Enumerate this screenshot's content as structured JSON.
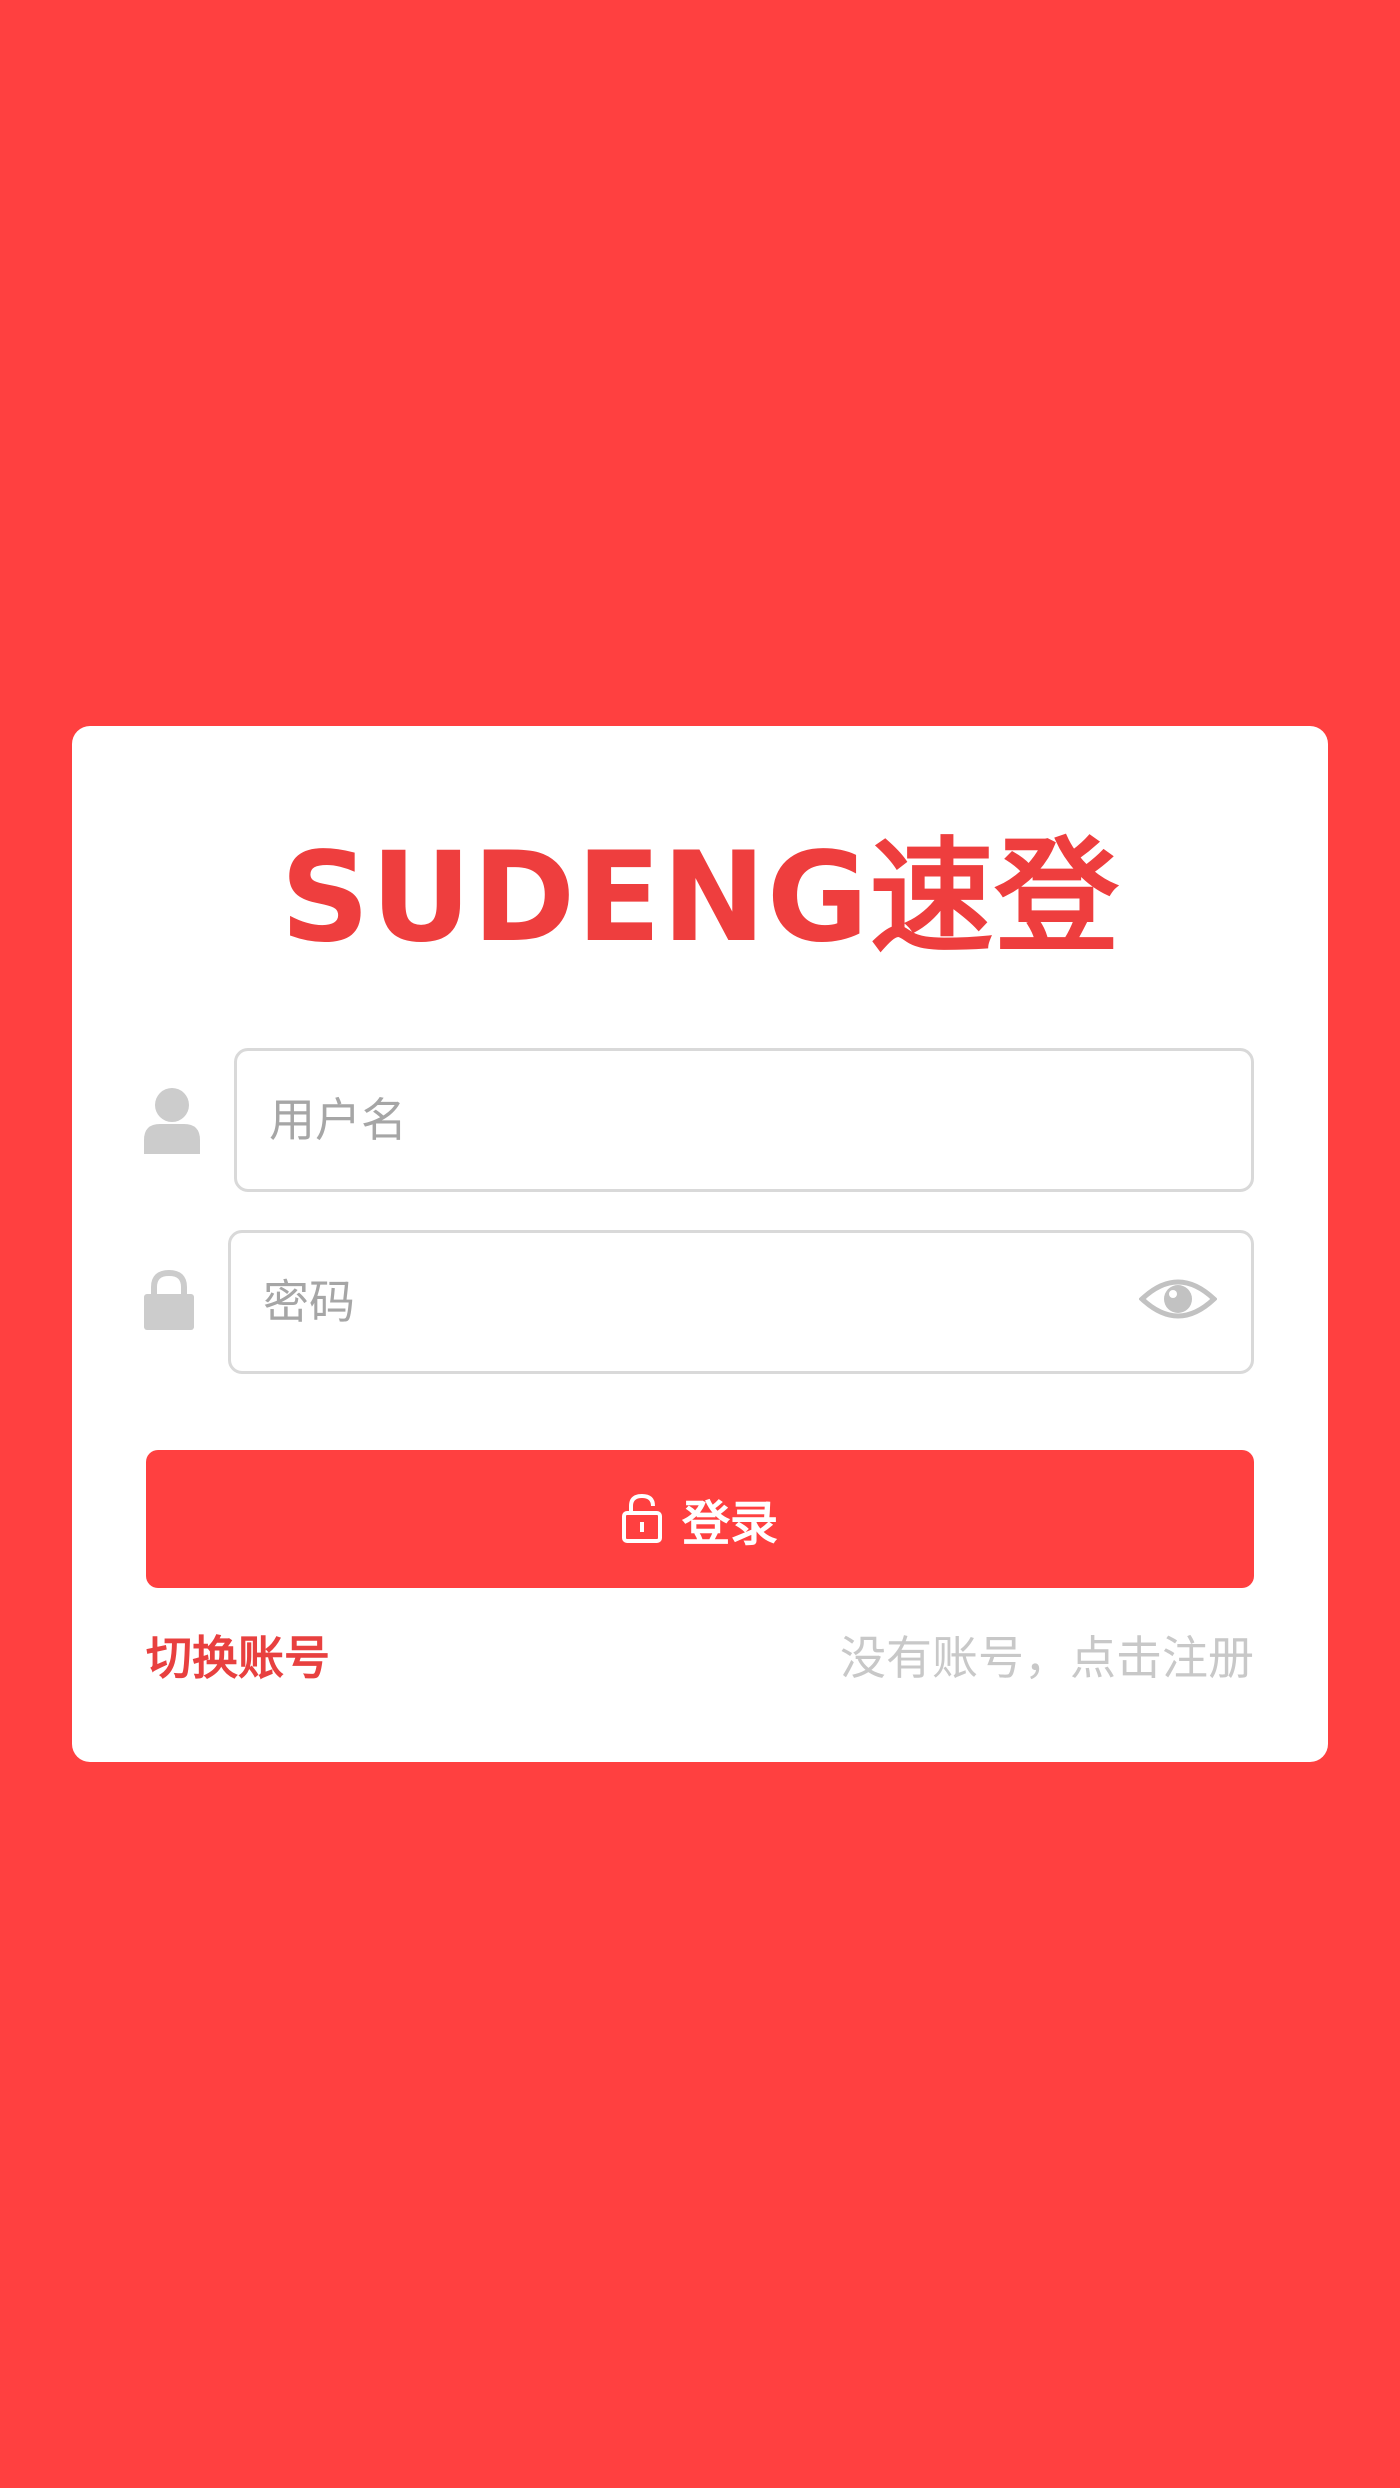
{
  "app": {
    "title": "SUDENG速登"
  },
  "form": {
    "username": {
      "value": "",
      "placeholder": "用户名",
      "icon": "user-icon"
    },
    "password": {
      "value": "",
      "placeholder": "密码",
      "icon": "lock-icon",
      "toggle_icon": "eye-icon"
    }
  },
  "actions": {
    "login_label": "登录",
    "login_icon": "lock-open-icon",
    "switch_account_label": "切换账号",
    "register_label": "没有账号，点击注册"
  },
  "colors": {
    "background": "#ff4040",
    "accent": "#ee3e3e",
    "muted_text": "#c8c8c8",
    "icon_gray": "#cccccc"
  }
}
